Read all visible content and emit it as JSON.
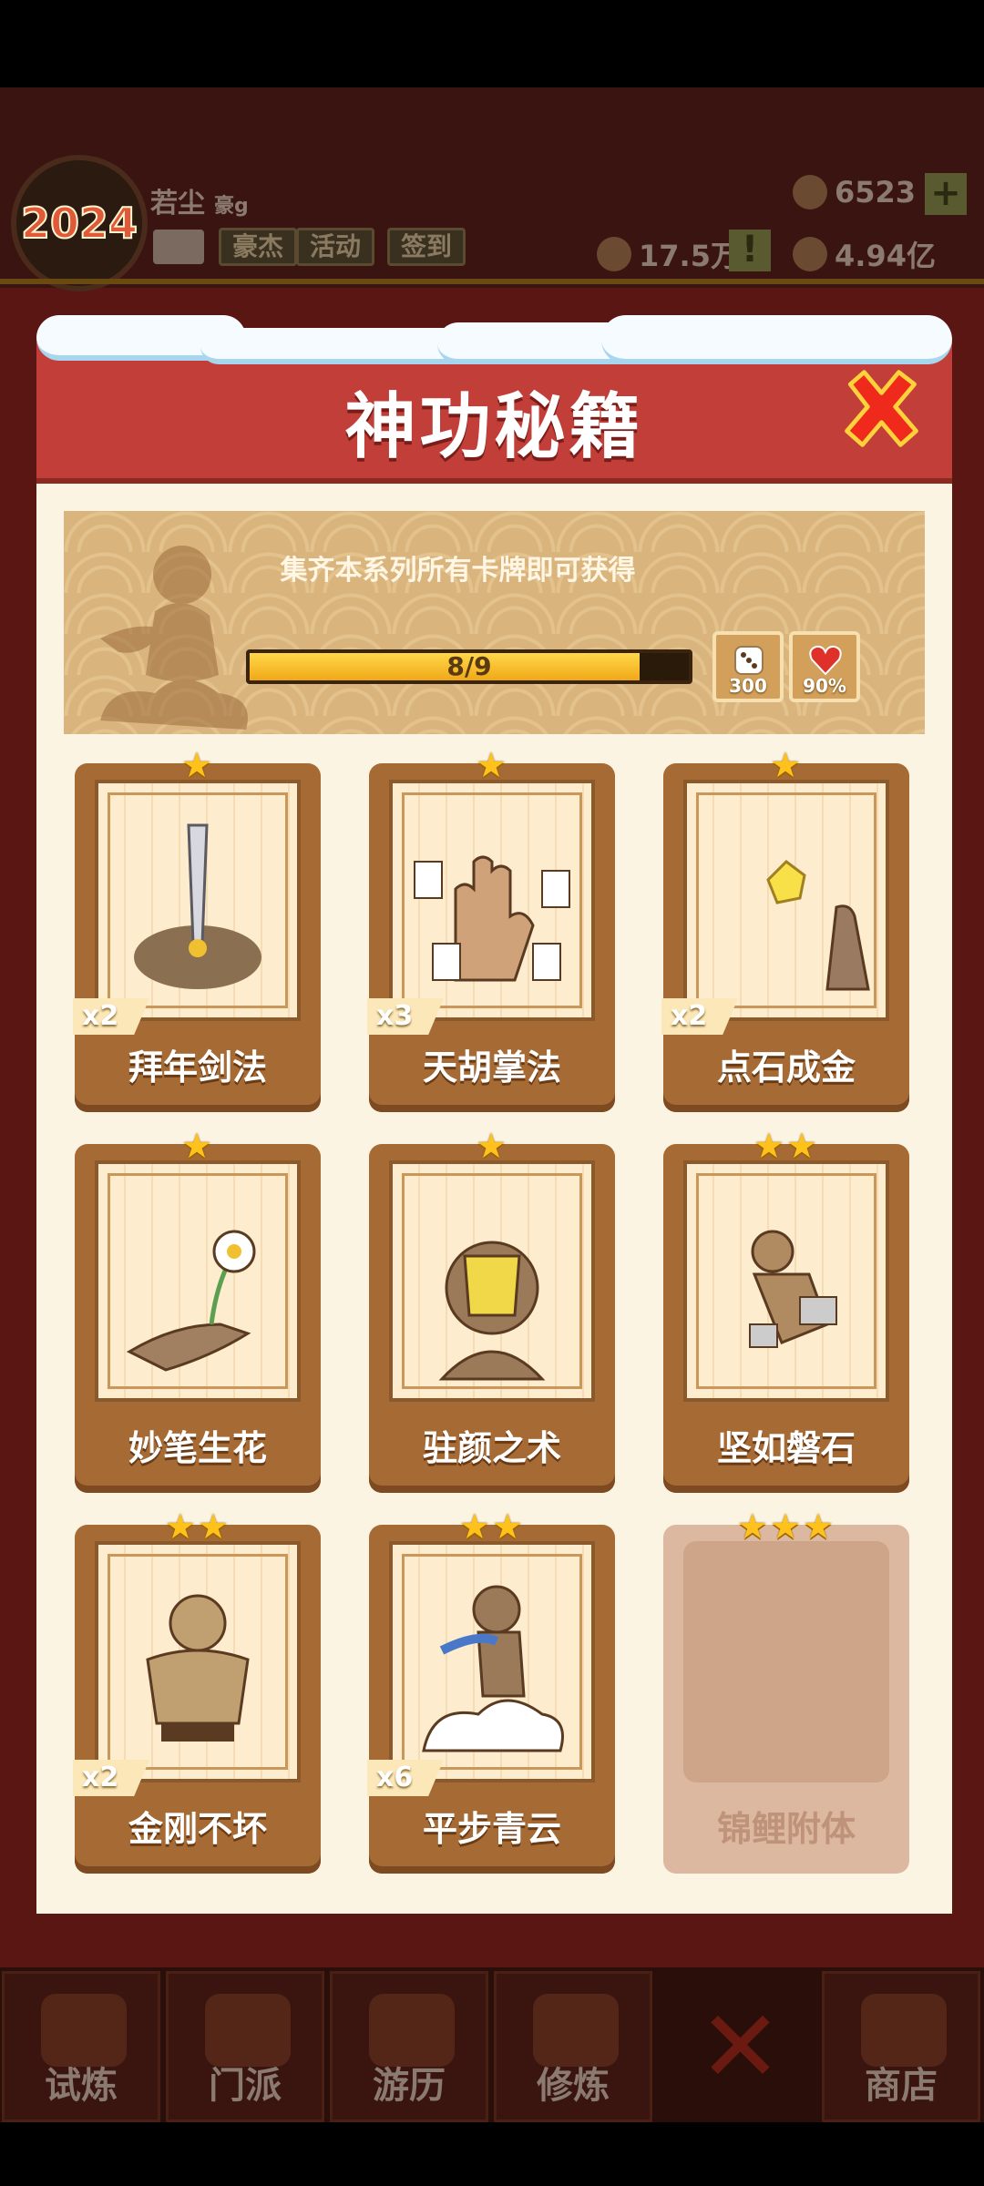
{
  "hud": {
    "year_badge": "2024",
    "player_name": "若尘",
    "player_title": "豪g",
    "tags": [
      "豪杰",
      "活动",
      "签到"
    ],
    "gems": "6523",
    "power": "17.5万",
    "coins": "4.94亿"
  },
  "nav": {
    "items": [
      {
        "label": "试炼"
      },
      {
        "label": "门派"
      },
      {
        "label": "游历"
      },
      {
        "label": "修炼"
      },
      {
        "label": "商店"
      }
    ]
  },
  "modal": {
    "title": "神功秘籍",
    "hint": "集齐本系列所有卡牌即可获得",
    "progress_text": "8/9",
    "progress_fraction": 0.889,
    "rewards": [
      {
        "icon": "dice-icon",
        "amount": "300"
      },
      {
        "icon": "heart-icon",
        "amount": "90%"
      }
    ],
    "cards": [
      {
        "name": "拜年剑法",
        "stars": "★",
        "count": "x2",
        "icon": "sword-icon"
      },
      {
        "name": "天胡掌法",
        "stars": "★",
        "count": "x3",
        "icon": "palm-mahjong-icon"
      },
      {
        "name": "点石成金",
        "stars": "★",
        "count": "x2",
        "icon": "golden-stone-icon"
      },
      {
        "name": "妙笔生花",
        "stars": "★",
        "count": "",
        "icon": "flower-hand-icon"
      },
      {
        "name": "驻颜之术",
        "stars": "★",
        "count": "",
        "icon": "face-mask-icon"
      },
      {
        "name": "坚如磐石",
        "stars": "★★",
        "count": "",
        "icon": "stone-body-icon"
      },
      {
        "name": "金刚不坏",
        "stars": "★★",
        "count": "x2",
        "icon": "muscle-man-icon"
      },
      {
        "name": "平步青云",
        "stars": "★★",
        "count": "x6",
        "icon": "cloud-rider-icon"
      },
      {
        "name": "锦鲤附体",
        "stars": "★★★",
        "count": "",
        "icon": "locked-card-icon"
      }
    ]
  },
  "colors": {
    "header_red": "#c13f38",
    "card_brown": "#a66a34",
    "star_gold": "#ffc21c",
    "progress_yellow": "#ffd84a"
  }
}
